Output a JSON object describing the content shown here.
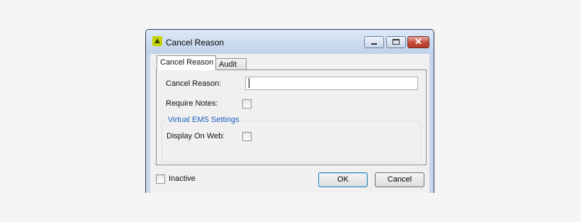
{
  "window": {
    "title": "Cancel Reason",
    "icon": "ems-app-icon",
    "controls": {
      "minimize_icon": "minimize-icon",
      "maximize_icon": "maximize-icon",
      "close_glyph": "✕"
    }
  },
  "tabs": [
    {
      "label": "Cancel Reason",
      "selected": true
    },
    {
      "label": "Audit",
      "selected": false
    }
  ],
  "form": {
    "cancel_reason_label": "Cancel Reason:",
    "cancel_reason_value": "",
    "require_notes_label": "Require Notes:",
    "require_notes_checked": false,
    "virtual_ems_group_title": "Virtual EMS Settings",
    "display_on_web_label": "Display On Web:",
    "display_on_web_checked": false
  },
  "footer": {
    "inactive_label": "Inactive",
    "inactive_checked": false,
    "ok_label": "OK",
    "cancel_label": "Cancel"
  },
  "colors": {
    "group_title": "#1e5fbf",
    "close_button": "#c44a36"
  }
}
